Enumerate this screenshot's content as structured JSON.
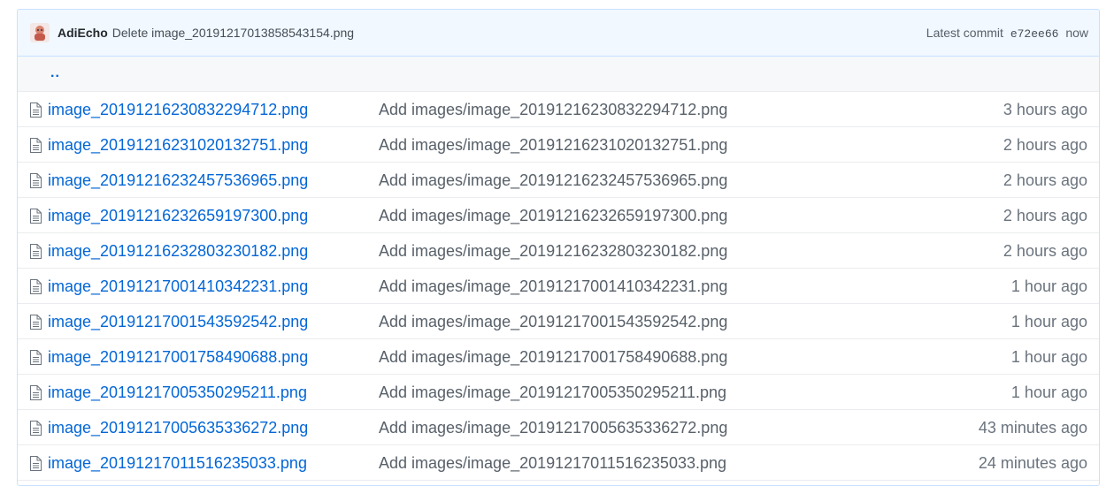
{
  "commit_bar": {
    "author": "AdiEcho",
    "message": "Delete image_20191217013858543154.png",
    "latest_label": "Latest commit",
    "sha": "e72ee66",
    "time": "now"
  },
  "parent_dir": {
    "label": ".."
  },
  "files": [
    {
      "name": "image_20191216230832294712.png",
      "message": "Add images/image_20191216230832294712.png",
      "age": "3 hours ago"
    },
    {
      "name": "image_20191216231020132751.png",
      "message": "Add images/image_20191216231020132751.png",
      "age": "2 hours ago"
    },
    {
      "name": "image_20191216232457536965.png",
      "message": "Add images/image_20191216232457536965.png",
      "age": "2 hours ago"
    },
    {
      "name": "image_20191216232659197300.png",
      "message": "Add images/image_20191216232659197300.png",
      "age": "2 hours ago"
    },
    {
      "name": "image_20191216232803230182.png",
      "message": "Add images/image_20191216232803230182.png",
      "age": "2 hours ago"
    },
    {
      "name": "image_20191217001410342231.png",
      "message": "Add images/image_20191217001410342231.png",
      "age": "1 hour ago"
    },
    {
      "name": "image_20191217001543592542.png",
      "message": "Add images/image_20191217001543592542.png",
      "age": "1 hour ago"
    },
    {
      "name": "image_20191217001758490688.png",
      "message": "Add images/image_20191217001758490688.png",
      "age": "1 hour ago"
    },
    {
      "name": "image_20191217005350295211.png",
      "message": "Add images/image_20191217005350295211.png",
      "age": "1 hour ago"
    },
    {
      "name": "image_20191217005635336272.png",
      "message": "Add images/image_20191217005635336272.png",
      "age": "43 minutes ago"
    },
    {
      "name": "image_20191217011516235033.png",
      "message": "Add images/image_20191217011516235033.png",
      "age": "24 minutes ago"
    }
  ],
  "icons": {
    "file": "file-icon",
    "avatar": "avatar"
  },
  "colors": {
    "link": "#0366d6",
    "header_bg": "#f1f8ff",
    "border": "#c8e1ff"
  }
}
